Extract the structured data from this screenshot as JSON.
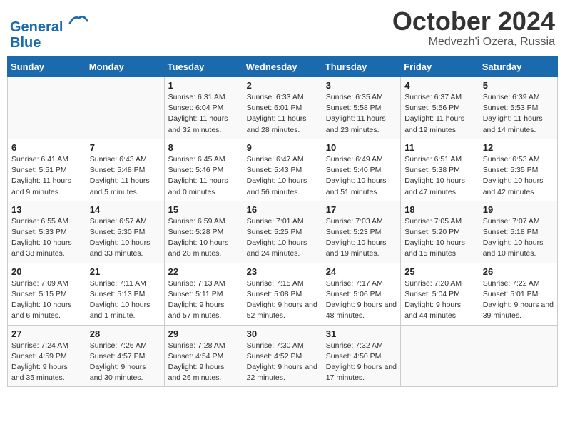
{
  "header": {
    "logo_line1": "General",
    "logo_line2": "Blue",
    "month": "October 2024",
    "location": "Medvezh'i Ozera, Russia"
  },
  "days_of_week": [
    "Sunday",
    "Monday",
    "Tuesday",
    "Wednesday",
    "Thursday",
    "Friday",
    "Saturday"
  ],
  "weeks": [
    [
      {
        "day": "",
        "info": ""
      },
      {
        "day": "",
        "info": ""
      },
      {
        "day": "1",
        "info": "Sunrise: 6:31 AM\nSunset: 6:04 PM\nDaylight: 11 hours and 32 minutes."
      },
      {
        "day": "2",
        "info": "Sunrise: 6:33 AM\nSunset: 6:01 PM\nDaylight: 11 hours and 28 minutes."
      },
      {
        "day": "3",
        "info": "Sunrise: 6:35 AM\nSunset: 5:58 PM\nDaylight: 11 hours and 23 minutes."
      },
      {
        "day": "4",
        "info": "Sunrise: 6:37 AM\nSunset: 5:56 PM\nDaylight: 11 hours and 19 minutes."
      },
      {
        "day": "5",
        "info": "Sunrise: 6:39 AM\nSunset: 5:53 PM\nDaylight: 11 hours and 14 minutes."
      }
    ],
    [
      {
        "day": "6",
        "info": "Sunrise: 6:41 AM\nSunset: 5:51 PM\nDaylight: 11 hours and 9 minutes."
      },
      {
        "day": "7",
        "info": "Sunrise: 6:43 AM\nSunset: 5:48 PM\nDaylight: 11 hours and 5 minutes."
      },
      {
        "day": "8",
        "info": "Sunrise: 6:45 AM\nSunset: 5:46 PM\nDaylight: 11 hours and 0 minutes."
      },
      {
        "day": "9",
        "info": "Sunrise: 6:47 AM\nSunset: 5:43 PM\nDaylight: 10 hours and 56 minutes."
      },
      {
        "day": "10",
        "info": "Sunrise: 6:49 AM\nSunset: 5:40 PM\nDaylight: 10 hours and 51 minutes."
      },
      {
        "day": "11",
        "info": "Sunrise: 6:51 AM\nSunset: 5:38 PM\nDaylight: 10 hours and 47 minutes."
      },
      {
        "day": "12",
        "info": "Sunrise: 6:53 AM\nSunset: 5:35 PM\nDaylight: 10 hours and 42 minutes."
      }
    ],
    [
      {
        "day": "13",
        "info": "Sunrise: 6:55 AM\nSunset: 5:33 PM\nDaylight: 10 hours and 38 minutes."
      },
      {
        "day": "14",
        "info": "Sunrise: 6:57 AM\nSunset: 5:30 PM\nDaylight: 10 hours and 33 minutes."
      },
      {
        "day": "15",
        "info": "Sunrise: 6:59 AM\nSunset: 5:28 PM\nDaylight: 10 hours and 28 minutes."
      },
      {
        "day": "16",
        "info": "Sunrise: 7:01 AM\nSunset: 5:25 PM\nDaylight: 10 hours and 24 minutes."
      },
      {
        "day": "17",
        "info": "Sunrise: 7:03 AM\nSunset: 5:23 PM\nDaylight: 10 hours and 19 minutes."
      },
      {
        "day": "18",
        "info": "Sunrise: 7:05 AM\nSunset: 5:20 PM\nDaylight: 10 hours and 15 minutes."
      },
      {
        "day": "19",
        "info": "Sunrise: 7:07 AM\nSunset: 5:18 PM\nDaylight: 10 hours and 10 minutes."
      }
    ],
    [
      {
        "day": "20",
        "info": "Sunrise: 7:09 AM\nSunset: 5:15 PM\nDaylight: 10 hours and 6 minutes."
      },
      {
        "day": "21",
        "info": "Sunrise: 7:11 AM\nSunset: 5:13 PM\nDaylight: 10 hours and 1 minute."
      },
      {
        "day": "22",
        "info": "Sunrise: 7:13 AM\nSunset: 5:11 PM\nDaylight: 9 hours and 57 minutes."
      },
      {
        "day": "23",
        "info": "Sunrise: 7:15 AM\nSunset: 5:08 PM\nDaylight: 9 hours and 52 minutes."
      },
      {
        "day": "24",
        "info": "Sunrise: 7:17 AM\nSunset: 5:06 PM\nDaylight: 9 hours and 48 minutes."
      },
      {
        "day": "25",
        "info": "Sunrise: 7:20 AM\nSunset: 5:04 PM\nDaylight: 9 hours and 44 minutes."
      },
      {
        "day": "26",
        "info": "Sunrise: 7:22 AM\nSunset: 5:01 PM\nDaylight: 9 hours and 39 minutes."
      }
    ],
    [
      {
        "day": "27",
        "info": "Sunrise: 7:24 AM\nSunset: 4:59 PM\nDaylight: 9 hours and 35 minutes."
      },
      {
        "day": "28",
        "info": "Sunrise: 7:26 AM\nSunset: 4:57 PM\nDaylight: 9 hours and 30 minutes."
      },
      {
        "day": "29",
        "info": "Sunrise: 7:28 AM\nSunset: 4:54 PM\nDaylight: 9 hours and 26 minutes."
      },
      {
        "day": "30",
        "info": "Sunrise: 7:30 AM\nSunset: 4:52 PM\nDaylight: 9 hours and 22 minutes."
      },
      {
        "day": "31",
        "info": "Sunrise: 7:32 AM\nSunset: 4:50 PM\nDaylight: 9 hours and 17 minutes."
      },
      {
        "day": "",
        "info": ""
      },
      {
        "day": "",
        "info": ""
      }
    ]
  ]
}
